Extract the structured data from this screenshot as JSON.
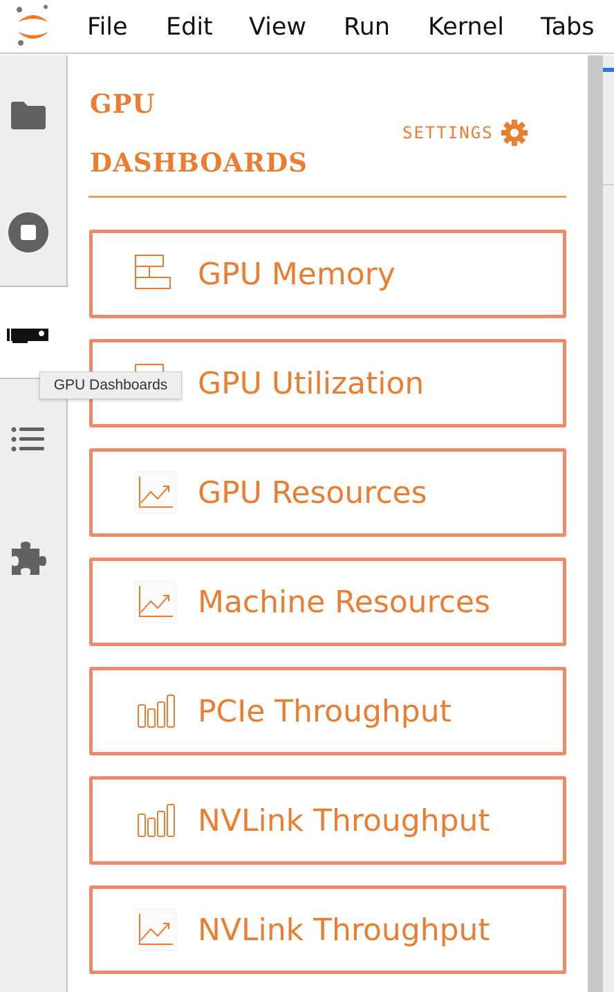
{
  "menubar": {
    "items": [
      "File",
      "Edit",
      "View",
      "Run",
      "Kernel",
      "Tabs"
    ]
  },
  "leftbar": {
    "icons": [
      "folder-icon",
      "stop-circle-icon",
      "gpu-card-icon",
      "list-icon",
      "puzzle-icon"
    ],
    "active": "gpu-card-icon"
  },
  "tooltip": {
    "text": "GPU Dashboards"
  },
  "panel": {
    "title": "GPU DASHBOARDS",
    "settings_label": "SETTINGS",
    "buttons": [
      {
        "label": "GPU Memory",
        "icon": "memory-blocks-icon"
      },
      {
        "label": "GPU Utilization",
        "icon": "memory-blocks-icon"
      },
      {
        "label": "GPU Resources",
        "icon": "line-chart-icon"
      },
      {
        "label": "Machine Resources",
        "icon": "line-chart-icon"
      },
      {
        "label": "PCIe Throughput",
        "icon": "bar-chart-icon"
      },
      {
        "label": "NVLink Throughput",
        "icon": "bar-chart-icon"
      },
      {
        "label": "NVLink Throughput",
        "icon": "line-chart-icon"
      }
    ]
  },
  "colors": {
    "accent": "#e97e32",
    "button_border": "#ee8a6a",
    "sidebar_bg": "#eeeeee",
    "icon_gray": "#616161"
  }
}
